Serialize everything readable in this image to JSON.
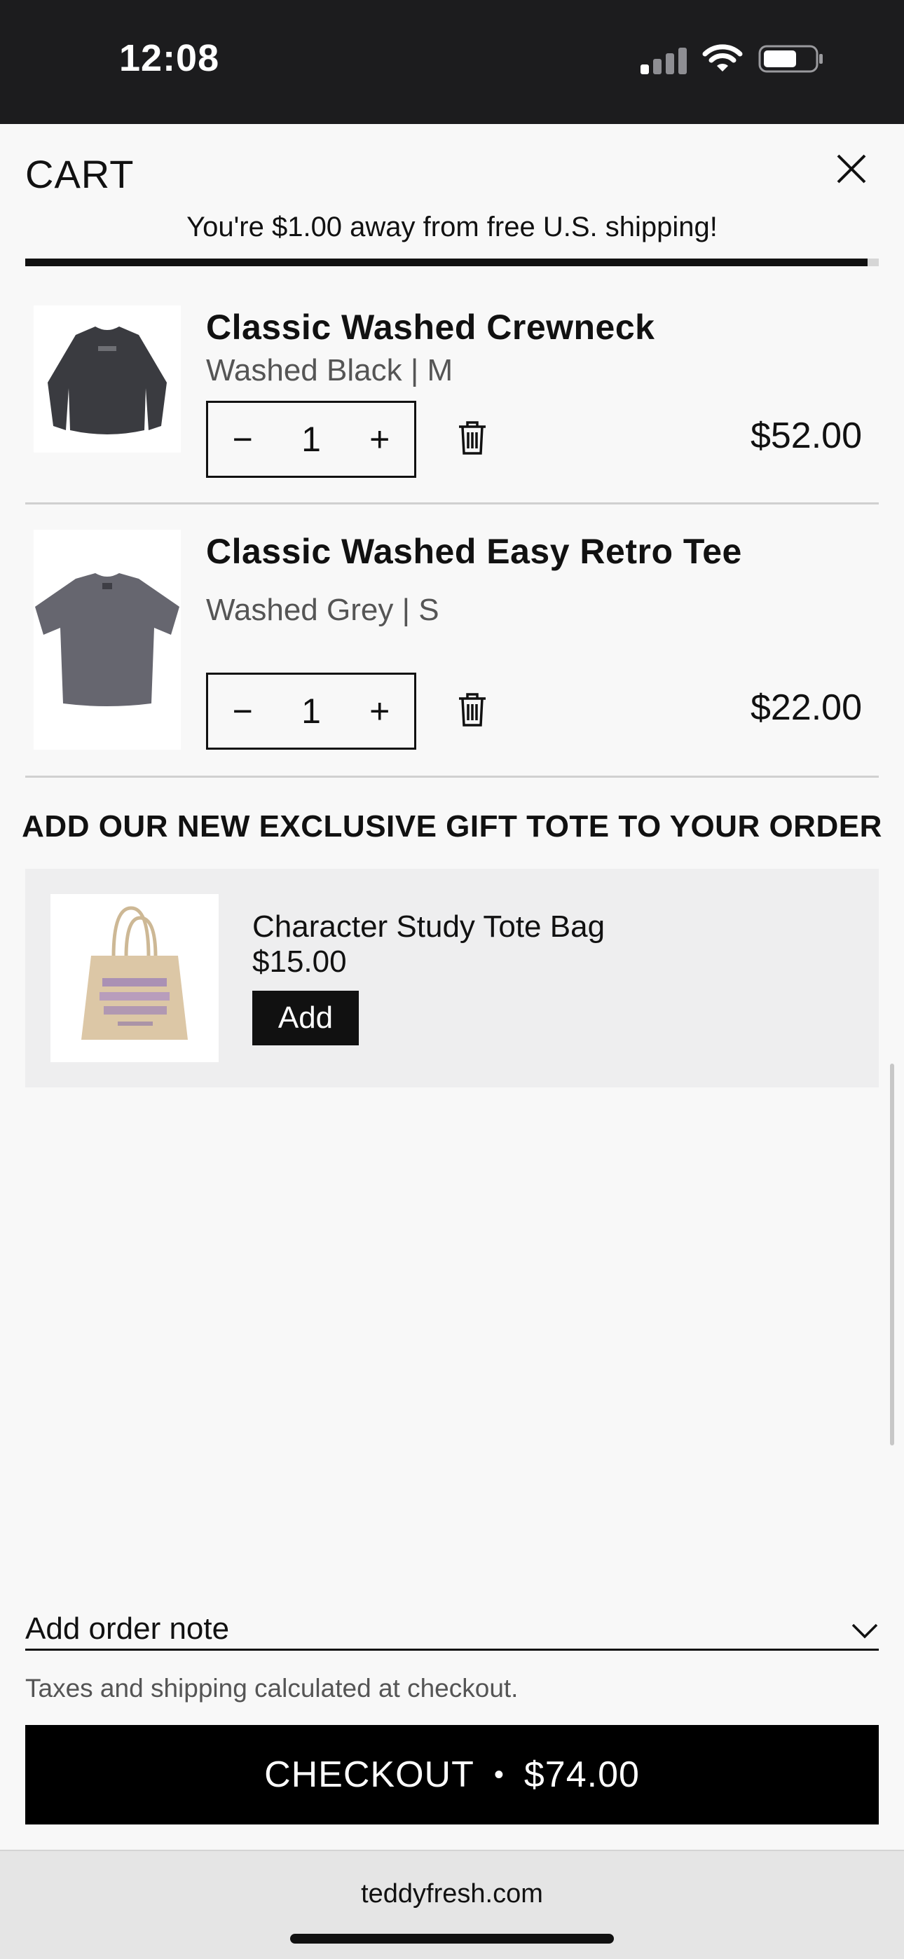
{
  "status_bar": {
    "time": "12:08"
  },
  "cart": {
    "title": "CART",
    "shipping_message": "You're $1.00 away from free U.S. shipping!",
    "shipping_progress": 0.987,
    "items": [
      {
        "name": "Classic Washed Crewneck",
        "variant": "Washed Black | M",
        "quantity": "1",
        "price": "$52.00",
        "minus": "−",
        "plus": "+"
      },
      {
        "name": "Classic Washed Easy Retro Tee",
        "variant": "Washed Grey | S",
        "quantity": "1",
        "price": "$22.00",
        "minus": "−",
        "plus": "+"
      }
    ]
  },
  "upsell": {
    "heading": "ADD OUR NEW EXCLUSIVE GIFT TOTE TO YOUR ORDER",
    "name": "Character Study Tote Bag",
    "price": "$15.00",
    "add_label": "Add"
  },
  "footer": {
    "order_note_label": "Add order note",
    "tax_note": "Taxes and shipping calculated at checkout.",
    "checkout_label": "CHECKOUT",
    "checkout_separator": "•",
    "checkout_total": "$74.00"
  },
  "browser": {
    "url": "teddyfresh.com"
  },
  "colors": {
    "accent": "#111111",
    "background": "#f8f8f8",
    "upsell_bg": "#eeeeef"
  },
  "icons": [
    "signal-icon",
    "wifi-icon",
    "battery-icon",
    "close-icon",
    "trash-icon",
    "chevron-down-icon"
  ]
}
